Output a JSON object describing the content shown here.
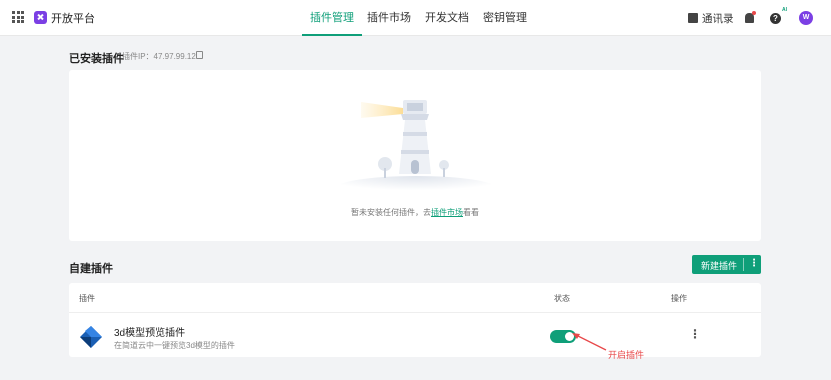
{
  "header": {
    "app_title": "开放平台",
    "nav": [
      {
        "label": "插件管理",
        "active": true
      },
      {
        "label": "插件市场",
        "active": false
      },
      {
        "label": "开发文档",
        "active": false
      },
      {
        "label": "密钥管理",
        "active": false
      }
    ],
    "contacts_label": "通讯录",
    "ai_badge": "AI",
    "help_glyph": "?",
    "avatar_initial": "W",
    "accent_color": "#0f9f79",
    "brand_color": "#7b3fe4"
  },
  "installed": {
    "title": "已安装插件",
    "ip_label": "插件IP：47.97.99.12",
    "empty_text_prefix": "暂未安装任何插件，去",
    "empty_link": "插件市场",
    "empty_text_suffix": "看看"
  },
  "custom": {
    "title": "自建插件",
    "new_button_label": "新建插件",
    "more_glyph": "⋮",
    "columns": [
      "插件",
      "状态",
      "操作"
    ],
    "rows": [
      {
        "name": "3d模型预览插件",
        "description": "在简道云中一键预览3d模型的插件",
        "enabled": true,
        "action_glyph": "⋮"
      }
    ]
  },
  "annotation": {
    "text": "开启插件",
    "color": "#e8484a"
  }
}
